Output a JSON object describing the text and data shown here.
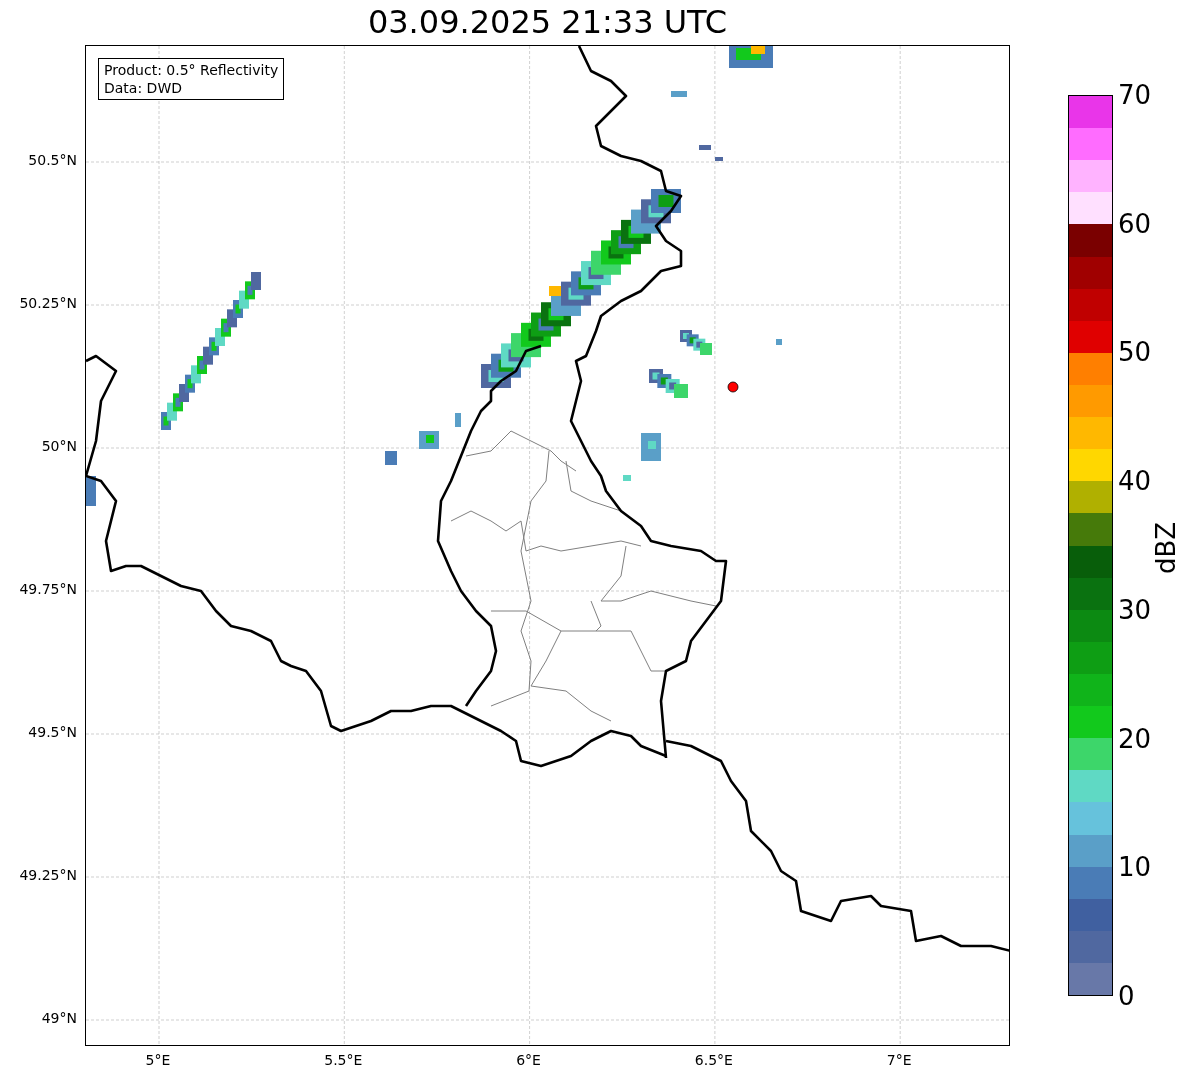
{
  "title": "03.09.2025 21:33 UTC",
  "legend": [
    "Product: 0.5° Reflectivity",
    "Data: DWD"
  ],
  "map": {
    "xticks": [
      "5°E",
      "5.5°E",
      "6°E",
      "6.5°E",
      "7°E"
    ],
    "yticks": [
      "50.5°N",
      "50.25°N",
      "50°N",
      "49.75°N",
      "49.5°N",
      "49.25°N",
      "49°N"
    ]
  },
  "colorbar": {
    "label": "dBZ",
    "ticks": [
      "70",
      "60",
      "50",
      "40",
      "30",
      "20",
      "10",
      "0"
    ],
    "segments": [
      {
        "color": "#e935e9"
      },
      {
        "color": "#ff6cff"
      },
      {
        "color": "#ffb3ff"
      },
      {
        "color": "#ffe0ff"
      },
      {
        "color": "#7a0000"
      },
      {
        "color": "#a00000"
      },
      {
        "color": "#c00000"
      },
      {
        "color": "#e00000"
      },
      {
        "color": "#ff7f00"
      },
      {
        "color": "#ff9a00"
      },
      {
        "color": "#ffb800"
      },
      {
        "color": "#ffd700"
      },
      {
        "color": "#b0b000"
      },
      {
        "color": "#467a0a"
      },
      {
        "color": "#085e0a"
      },
      {
        "color": "#0a7210"
      },
      {
        "color": "#0c8a12"
      },
      {
        "color": "#0e9e14"
      },
      {
        "color": "#10b41a"
      },
      {
        "color": "#12c91c"
      },
      {
        "color": "#3dd66a"
      },
      {
        "color": "#5fd9c4"
      },
      {
        "color": "#66c2dc"
      },
      {
        "color": "#5a9fc8"
      },
      {
        "color": "#4a7cb6"
      },
      {
        "color": "#4060a0"
      },
      {
        "color": "#5068a0"
      },
      {
        "color": "#6878a8"
      }
    ]
  }
}
